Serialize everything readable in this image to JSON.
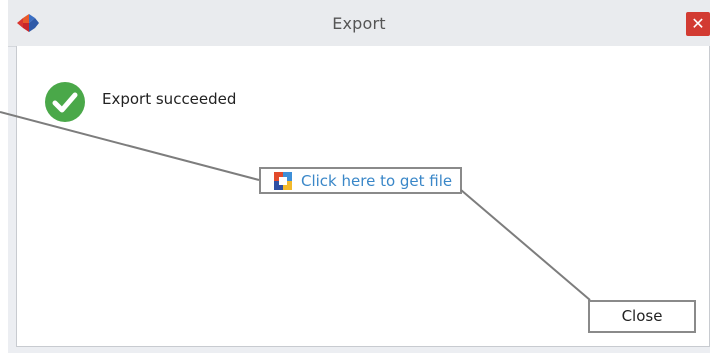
{
  "window": {
    "title": "Export"
  },
  "titlebar": {
    "close_glyph": "✕",
    "logo_icon": "app-logo-icon"
  },
  "message": {
    "text": "Export succeeded",
    "icon": "success-check-icon",
    "color": "#4aa849"
  },
  "link": {
    "label": "Click here to get file",
    "icon": "file-icon",
    "color": "#3a87c8"
  },
  "buttons": {
    "close_label": "Close"
  }
}
